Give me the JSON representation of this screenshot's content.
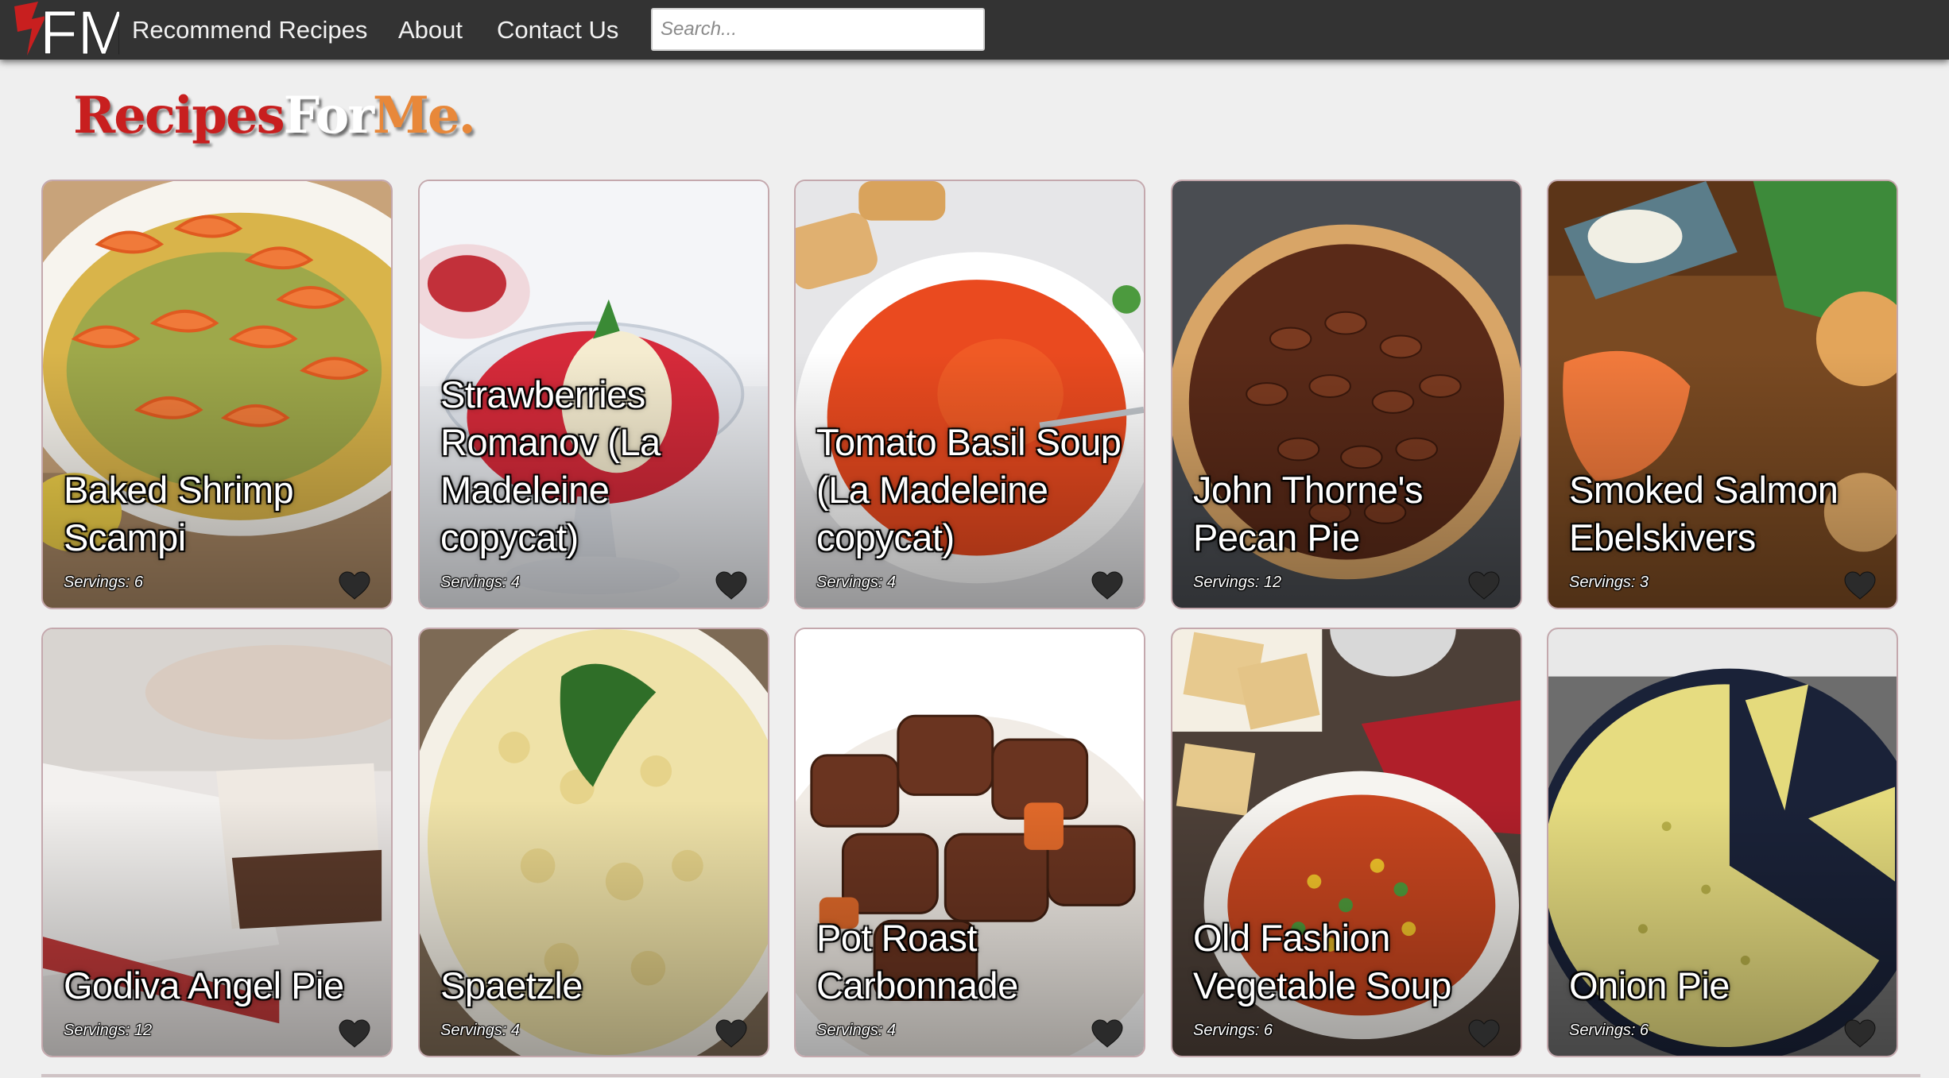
{
  "nav": {
    "logo_text": "FM",
    "links": [
      "Recommend Recipes",
      "About",
      "Contact Us"
    ],
    "search_placeholder": "Search..."
  },
  "brand": {
    "part1": "Recipes",
    "part2": "For",
    "part3": "Me."
  },
  "recipes": [
    {
      "title": "Baked Shrimp Scampi",
      "servings": "Servings: 6"
    },
    {
      "title": "Strawberries Romanov (La Madeleine copycat)",
      "servings": "Servings: 4"
    },
    {
      "title": "Tomato Basil Soup (La Madeleine copycat)",
      "servings": "Servings: 4"
    },
    {
      "title": "John Thorne's Pecan Pie",
      "servings": "Servings: 12"
    },
    {
      "title": "Smoked Salmon Ebelskivers",
      "servings": "Servings: 3"
    },
    {
      "title": "Godiva Angel Pie",
      "servings": "Servings: 12"
    },
    {
      "title": "Spaetzle",
      "servings": "Servings: 4"
    },
    {
      "title": "Pot Roast Carbonnade",
      "servings": "Servings: 4"
    },
    {
      "title": "Old Fashion Vegetable Soup",
      "servings": "Servings: 6"
    },
    {
      "title": "Onion Pie",
      "servings": "Servings: 6"
    }
  ],
  "colors": {
    "navbar": "#333333",
    "brand_red": "#c81f1f",
    "brand_orange": "#e8883a",
    "page_bg": "#efefef",
    "heart": "#2b2b2b"
  },
  "icons": {
    "favorite": "heart-icon",
    "logo": "fm-logo-icon"
  }
}
